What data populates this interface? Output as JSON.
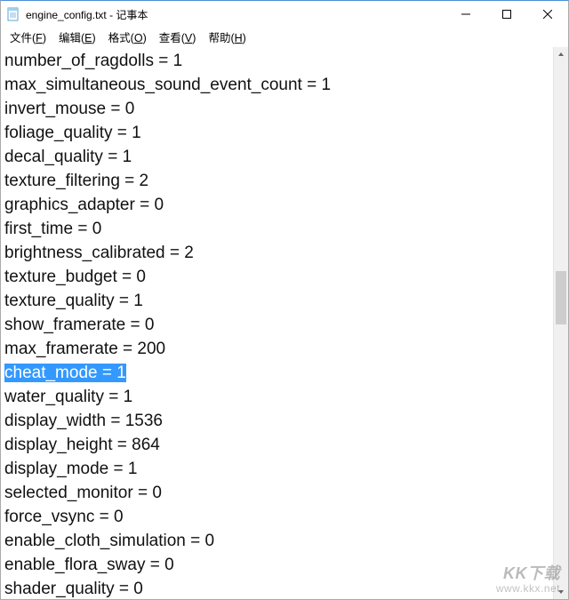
{
  "window": {
    "title": "engine_config.txt - 记事本"
  },
  "menu": {
    "file": "文件(F)",
    "edit": "编辑(E)",
    "format": "格式(O)",
    "view": "查看(V)",
    "help": "帮助(H)"
  },
  "lines": [
    {
      "text": "number_of_ragdolls = 1",
      "selected": false
    },
    {
      "text": "max_simultaneous_sound_event_count = 1",
      "selected": false
    },
    {
      "text": "invert_mouse = 0",
      "selected": false
    },
    {
      "text": "foliage_quality = 1",
      "selected": false
    },
    {
      "text": "decal_quality = 1",
      "selected": false
    },
    {
      "text": "texture_filtering = 2",
      "selected": false
    },
    {
      "text": "graphics_adapter = 0",
      "selected": false
    },
    {
      "text": "first_time = 0",
      "selected": false
    },
    {
      "text": "brightness_calibrated = 2",
      "selected": false
    },
    {
      "text": "texture_budget = 0",
      "selected": false
    },
    {
      "text": "texture_quality = 1",
      "selected": false
    },
    {
      "text": "show_framerate = 0",
      "selected": false
    },
    {
      "text": "max_framerate = 200",
      "selected": false
    },
    {
      "text": "cheat_mode = 1",
      "selected": true
    },
    {
      "text": "water_quality = 1",
      "selected": false
    },
    {
      "text": "display_width = 1536",
      "selected": false
    },
    {
      "text": "display_height = 864",
      "selected": false
    },
    {
      "text": "display_mode = 1",
      "selected": false
    },
    {
      "text": "selected_monitor = 0",
      "selected": false
    },
    {
      "text": "force_vsync = 0",
      "selected": false
    },
    {
      "text": "enable_cloth_simulation = 0",
      "selected": false
    },
    {
      "text": "enable_flora_sway = 0",
      "selected": false
    },
    {
      "text": "shader_quality = 0",
      "selected": false
    }
  ],
  "watermark": {
    "main": "KK下载",
    "sub": "www.kkx.net"
  }
}
